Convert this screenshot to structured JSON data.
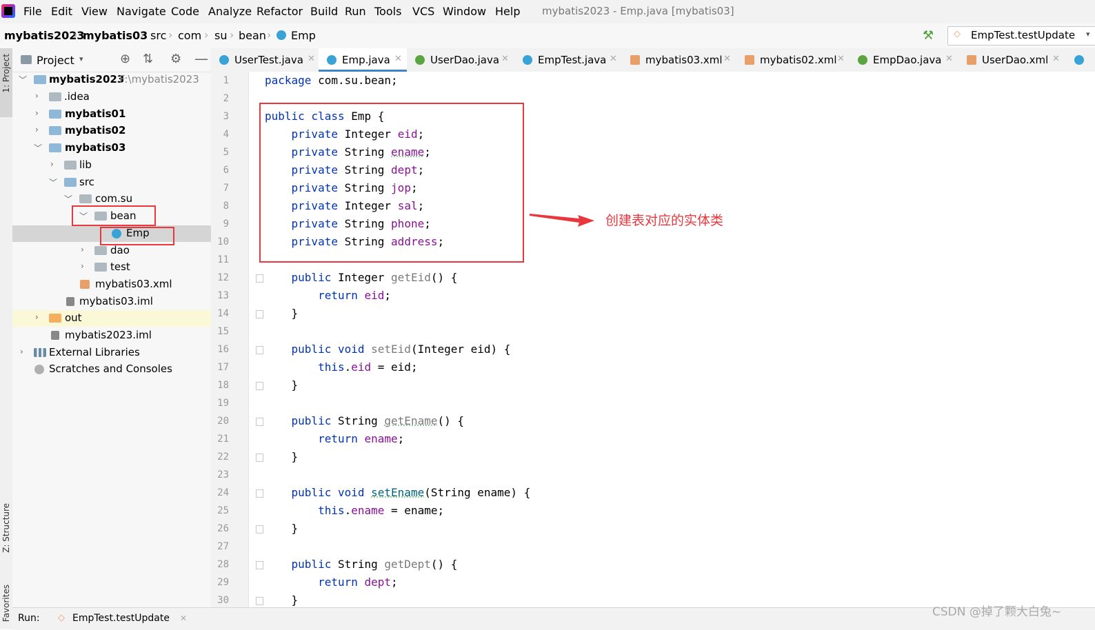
{
  "menu": {
    "items": [
      "File",
      "Edit",
      "View",
      "Navigate",
      "Code",
      "Analyze",
      "Refactor",
      "Build",
      "Run",
      "Tools",
      "VCS",
      "Window",
      "Help"
    ],
    "window_title": "mybatis2023 - Emp.java [mybatis03]"
  },
  "breadcrumb": [
    "mybatis2023",
    "mybatis03",
    "src",
    "com",
    "su",
    "bean",
    "Emp"
  ],
  "run_config": "EmpTest.testUpdate",
  "left_strip": {
    "project": "1: Project",
    "structure": "Z: Structure",
    "favorites": "Favorites"
  },
  "project_panel": {
    "title": "Project",
    "tree": [
      {
        "label": "mybatis2023",
        "hint": "F:\\mybatis2023",
        "bold": true
      },
      {
        "label": ".idea"
      },
      {
        "label": "mybatis01",
        "bold": true
      },
      {
        "label": "mybatis02",
        "bold": true
      },
      {
        "label": "mybatis03",
        "bold": true
      },
      {
        "label": "lib"
      },
      {
        "label": "src"
      },
      {
        "label": "com.su"
      },
      {
        "label": "bean"
      },
      {
        "label": "Emp"
      },
      {
        "label": "dao"
      },
      {
        "label": "test"
      },
      {
        "label": "mybatis03.xml"
      },
      {
        "label": "mybatis03.iml"
      },
      {
        "label": "out"
      },
      {
        "label": "mybatis2023.iml"
      },
      {
        "label": "External Libraries"
      },
      {
        "label": "Scratches and Consoles"
      }
    ]
  },
  "tabs": [
    {
      "label": "UserTest.java",
      "icon": "class-test-icon"
    },
    {
      "label": "Emp.java",
      "icon": "class-icon",
      "active": true
    },
    {
      "label": "UserDao.java",
      "icon": "interface-icon"
    },
    {
      "label": "EmpTest.java",
      "icon": "class-test-icon"
    },
    {
      "label": "mybatis03.xml",
      "icon": "xml-icon"
    },
    {
      "label": "mybatis02.xml",
      "icon": "xml-icon"
    },
    {
      "label": "EmpDao.java",
      "icon": "interface-icon"
    },
    {
      "label": "UserDao.xml",
      "icon": "xml-icon"
    }
  ],
  "editor": {
    "line_numbers": [
      "1",
      "2",
      "3",
      "4",
      "5",
      "6",
      "7",
      "8",
      "9",
      "10",
      "11",
      "12",
      "13",
      "14",
      "15",
      "16",
      "17",
      "18",
      "19",
      "20",
      "21",
      "22",
      "23",
      "24",
      "25",
      "26",
      "27",
      "28",
      "29",
      "30"
    ],
    "code": {
      "l1": {
        "kw": "package",
        "rest": " com.su.bean;"
      },
      "l3": {
        "kw": "public class",
        "rest": " Emp {"
      },
      "fields": [
        {
          "type": "Integer",
          "name": "eid"
        },
        {
          "type": "String",
          "name": "ename"
        },
        {
          "type": "String",
          "name": "dept"
        },
        {
          "type": "String",
          "name": "jop"
        },
        {
          "type": "Integer",
          "name": "sal"
        },
        {
          "type": "String",
          "name": "phone"
        },
        {
          "type": "String",
          "name": "address"
        }
      ],
      "private_kw": "private",
      "public_kw": "public",
      "void_kw": "void",
      "return_kw": "return",
      "this_kw": "this",
      "l12": {
        "type": "Integer",
        "method": "getEid",
        "tail": "() {"
      },
      "l13": {
        "field": "eid"
      },
      "l16": {
        "method": "setEid",
        "params": "(Integer eid) {"
      },
      "l17": {
        "field": "eid",
        "rhs": " = eid;"
      },
      "l20": {
        "type": "String",
        "method": "getEname",
        "tail": "() {"
      },
      "l21": {
        "field": "ename"
      },
      "l24": {
        "method": "setEname",
        "params": "(String ename) {"
      },
      "l25": {
        "field": "ename",
        "rhs": " = ename;"
      },
      "l28": {
        "type": "String",
        "method": "getDept",
        "tail": "() {"
      },
      "l29": {
        "field": "dept"
      },
      "close_brace": "}",
      "semicolon": ";"
    }
  },
  "annotation": "创建表对应的实体类",
  "bottom": {
    "run_label": "Run:",
    "run_tab": "EmpTest.testUpdate"
  },
  "watermark": "CSDN @掉了颗大白兔~",
  "colors": {
    "annotation_red": "#e8383d",
    "keyword": "#0033b3",
    "field": "#871094",
    "active_tab_underline": "#4083c9"
  }
}
